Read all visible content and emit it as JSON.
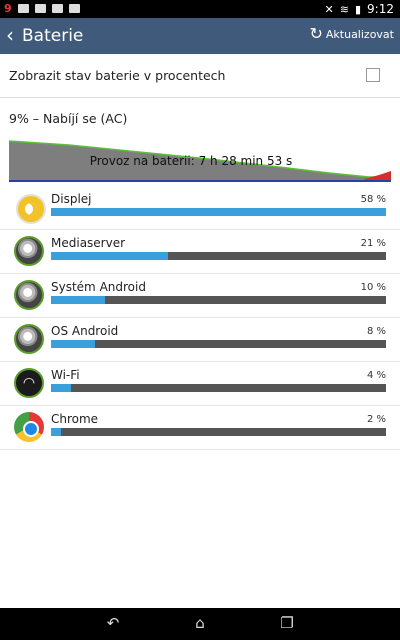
{
  "status_bar": {
    "notification_count": "9",
    "time": "9:12"
  },
  "app_bar": {
    "title": "Baterie",
    "refresh_label": "Aktualizovat"
  },
  "preference": {
    "label": "Zobrazit stav baterie v procentech",
    "checked": false
  },
  "battery": {
    "status": "9% – Nabíjí se (AC)",
    "graph_label": "Provoz na baterii: 7 h 28 min 53 s"
  },
  "usage": [
    {
      "name": "Displej",
      "percent_label": "58 %",
      "fraction": 1.0,
      "icon": "display-icon"
    },
    {
      "name": "Mediaserver",
      "percent_label": "21 %",
      "fraction": 0.35,
      "icon": "android-gear-icon"
    },
    {
      "name": "Systém Android",
      "percent_label": "10 %",
      "fraction": 0.16,
      "icon": "android-gear-icon"
    },
    {
      "name": "OS Android",
      "percent_label": "8 %",
      "fraction": 0.13,
      "icon": "android-gear-icon"
    },
    {
      "name": "Wi-Fi",
      "percent_label": "4 %",
      "fraction": 0.06,
      "icon": "wifi-icon"
    },
    {
      "name": "Chrome",
      "percent_label": "2 %",
      "fraction": 0.03,
      "icon": "chrome-icon"
    }
  ],
  "colors": {
    "appbar": "#3f5a7a",
    "bar_fill": "#3aa0dc",
    "bar_bg": "#555555"
  }
}
